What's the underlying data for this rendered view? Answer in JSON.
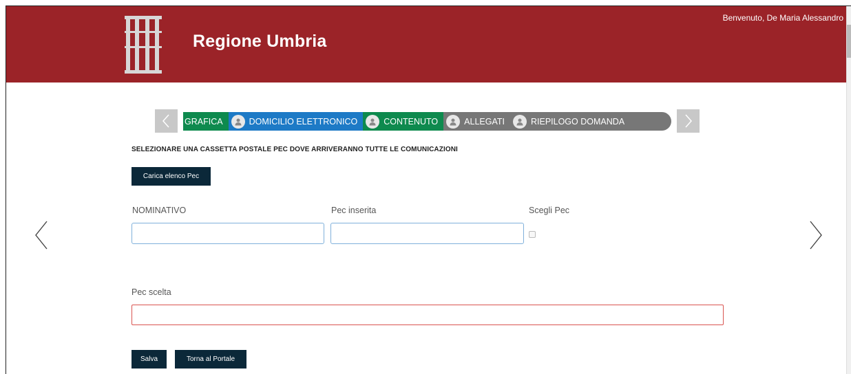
{
  "header": {
    "brand": "Regione Umbria",
    "welcome": "Benvenuto, De Maria Alessandro",
    "color": "#9b2328"
  },
  "steps": [
    {
      "label": "GRAFICA",
      "color": "#0e8a4e",
      "icon": "person-icon"
    },
    {
      "label": "DOMICILIO ELETTRONICO",
      "color": "#1d7ac6",
      "icon": "person-icon"
    },
    {
      "label": "CONTENUTO",
      "color": "#0e8a4e",
      "icon": "person-icon"
    },
    {
      "label": "ALLEGATI",
      "color": "#777777",
      "icon": "person-icon"
    },
    {
      "label": "RIEPILOGO DOMANDA",
      "color": "#777777",
      "icon": "person-icon"
    }
  ],
  "form": {
    "instruction": "SELEZIONARE UNA CASSETTA POSTALE PEC DOVE ARRIVERANNO TUTTE LE COMUNICAZIONI",
    "load_button": "Carica elenco Pec",
    "col_nominativo": "NOMINATIVO",
    "col_pec_inserita": "Pec inserita",
    "col_scegli": "Scegli Pec",
    "nominativo_value": "",
    "pec_inserita_value": "",
    "pec_scelta_label": "Pec scelta",
    "pec_scelta_value": ""
  },
  "actions": {
    "save": "Salva",
    "back": "Torna al Portale"
  }
}
